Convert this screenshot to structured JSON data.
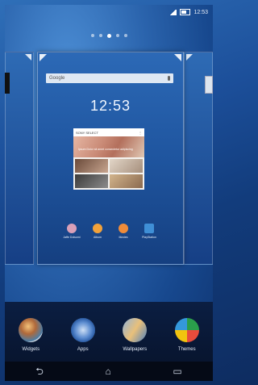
{
  "status_bar": {
    "time": "12:53"
  },
  "page_indicator": {
    "count": 5,
    "active_index": 2
  },
  "home_panel": {
    "search_placeholder": "Google",
    "clock": "12:53",
    "date": "",
    "widget": {
      "header_left": "SONY SELECT",
      "caption": "Ipsum Dolor sit amet consectetur adipiscing"
    },
    "apps": [
      {
        "label": "Jaffe Dolsomi",
        "color": "#d9a0b8"
      },
      {
        "label": "Album",
        "color": "#f2a23a"
      },
      {
        "label": "Movies",
        "color": "#ef8c3a"
      },
      {
        "label": "PlayStation",
        "color": "#3f8fd6"
      }
    ]
  },
  "dock": {
    "items": [
      {
        "label": "Widgets",
        "icon": "widgets-icon"
      },
      {
        "label": "Apps",
        "icon": "apps-icon"
      },
      {
        "label": "Wallpapers",
        "icon": "wallpapers-icon"
      },
      {
        "label": "Themes",
        "icon": "themes-icon"
      }
    ]
  },
  "navbar": {
    "back": "⮌",
    "home": "⌂",
    "recent": "▭"
  }
}
